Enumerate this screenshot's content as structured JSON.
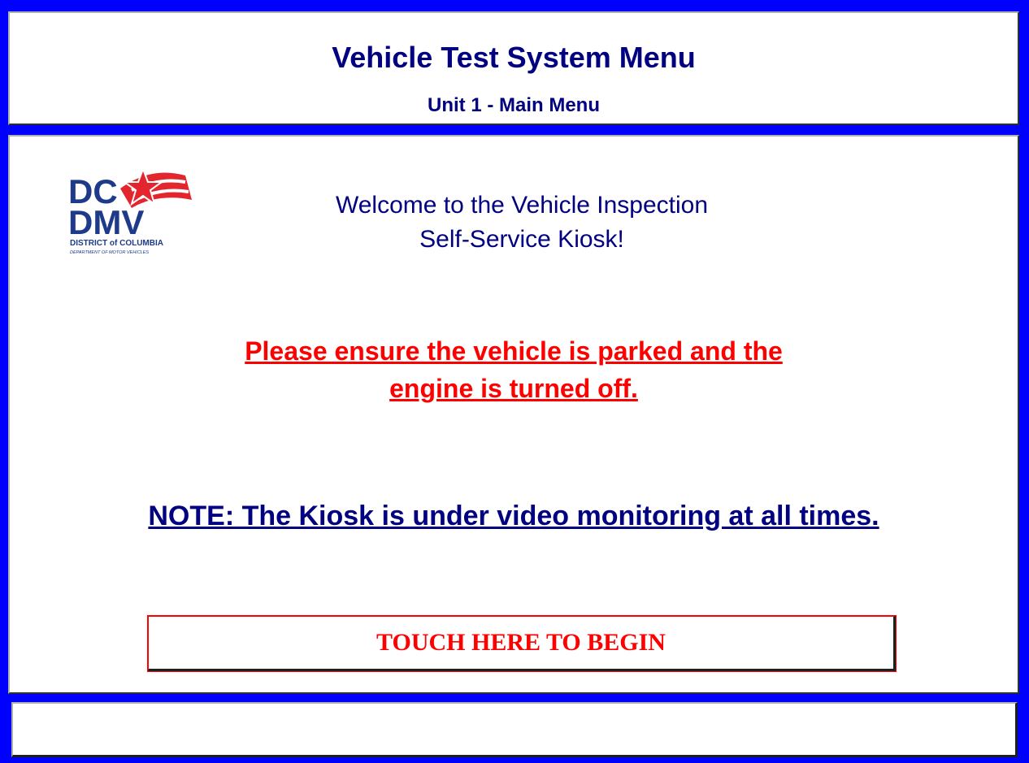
{
  "header": {
    "title": "Vehicle Test System Menu",
    "subtitle": "Unit 1 - Main Menu"
  },
  "logo": {
    "line1": "DC",
    "line2": "DMV",
    "line3": "DISTRICT of COLUMBIA",
    "line4": "DEPARTMENT OF MOTOR VEHICLES",
    "icon": "dc-dmv-logo-star-flag"
  },
  "main": {
    "welcome_line1": "Welcome to the Vehicle Inspection",
    "welcome_line2": "Self-Service Kiosk!",
    "warning_line1": "Please ensure the vehicle is parked and the",
    "warning_line2": "engine is turned off.",
    "note": "NOTE: The Kiosk is under video monitoring at all times.",
    "begin_label": "TOUCH HERE TO BEGIN"
  },
  "footer": {
    "status_text": ""
  },
  "colors": {
    "frame": "#0000FF",
    "navy_text": "#000080",
    "warning_red": "#FF0000",
    "logo_blue": "#1E3A8A",
    "logo_red": "#E3262E"
  }
}
